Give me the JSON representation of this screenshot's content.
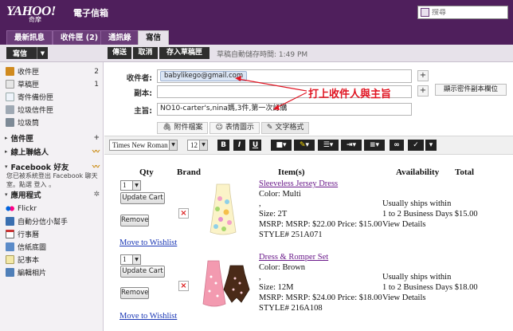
{
  "header": {
    "logo_main": "YAHOO!",
    "logo_sub": "奇摩",
    "app_title": "電子信箱",
    "search_placeholder": "搜尋"
  },
  "tabs": [
    {
      "label": "最新訊息"
    },
    {
      "label": "收件匣 (2)"
    },
    {
      "label": "通訊錄"
    },
    {
      "label": "寫信"
    }
  ],
  "toolbar": {
    "mail_label": "寫信",
    "send": "傳送",
    "cancel": "取消",
    "save_draft": "存入草稿匣",
    "autosave": "草稿自動儲存時間:  1:49 PM"
  },
  "sidebar": {
    "folders": [
      {
        "label": "收件匣",
        "count": "2"
      },
      {
        "label": "草稿匣",
        "count": "1"
      },
      {
        "label": "寄件備份匣",
        "count": ""
      },
      {
        "label": "垃圾信件匣",
        "count": ""
      },
      {
        "label": "垃圾筒",
        "count": ""
      }
    ],
    "sections": [
      {
        "label": "信件匣"
      },
      {
        "label": "線上聯絡人"
      },
      {
        "label": "Facebook 好友"
      },
      {
        "label": "應用程式"
      }
    ],
    "facebook_text": "您已被系統登出 Facebook 聊天室。點選 登入 。",
    "apps": [
      {
        "label": "Flickr"
      },
      {
        "label": "自動分信小幫手"
      },
      {
        "label": "行事曆"
      },
      {
        "label": "信紙底圖"
      },
      {
        "label": "記事本"
      },
      {
        "label": "編輯相片"
      }
    ]
  },
  "compose": {
    "to_label": "收件者:",
    "to_value": "babylikego@gmail.com",
    "cc_label": "副本:",
    "subject_label": "主旨:",
    "subject_value": "NO10-carter's,nina媽,3件,第一次訂購",
    "cc_toggle": "顯示密件副本欄位",
    "annotation": "打上收件人與主旨",
    "attach_tabs": [
      "附件檔案",
      "表情圖示",
      "文字格式"
    ]
  },
  "format": {
    "font": "Times New Roman",
    "size": "12",
    "bold": "B",
    "italic": "I",
    "underline": "U"
  },
  "cart": {
    "headers": {
      "qty": "Qty",
      "brand": "Brand",
      "items": "Item(s)",
      "availability": "Availability",
      "total": "Total"
    },
    "update_label": "Update Cart",
    "remove_label": "Remove",
    "wishlist_label": "Move to Wishlist",
    "items": [
      {
        "qty": "1",
        "name": "Sleeveless Jersey Dress",
        "color": "Color: Multi",
        "comma": ",",
        "size": "Size: 2T",
        "price": "MSRP: MSRP: $22.00 Price: $15.00",
        "style": "STYLE# 251A071",
        "avail1": "Usually ships within",
        "avail2": "1 to 2 Business Days $15.00",
        "avail3": "View Details"
      },
      {
        "qty": "1",
        "name": "Dress & Romper Set",
        "color": "Color: Brown",
        "comma": ",",
        "size": "Size: 12M",
        "price": "MSRP: MSRP: $24.00 Price: $18.00",
        "style": "STYLE# 216A108",
        "avail1": "Usually ships within",
        "avail2": "1 to 2 Business Days $18.00",
        "avail3": "View Details"
      }
    ]
  },
  "colors": {
    "brand_purple": "#4f1f5c",
    "annotation_red": "#e01522",
    "link_blue": "#1a37b5",
    "product_link": "#6a1a8a"
  }
}
